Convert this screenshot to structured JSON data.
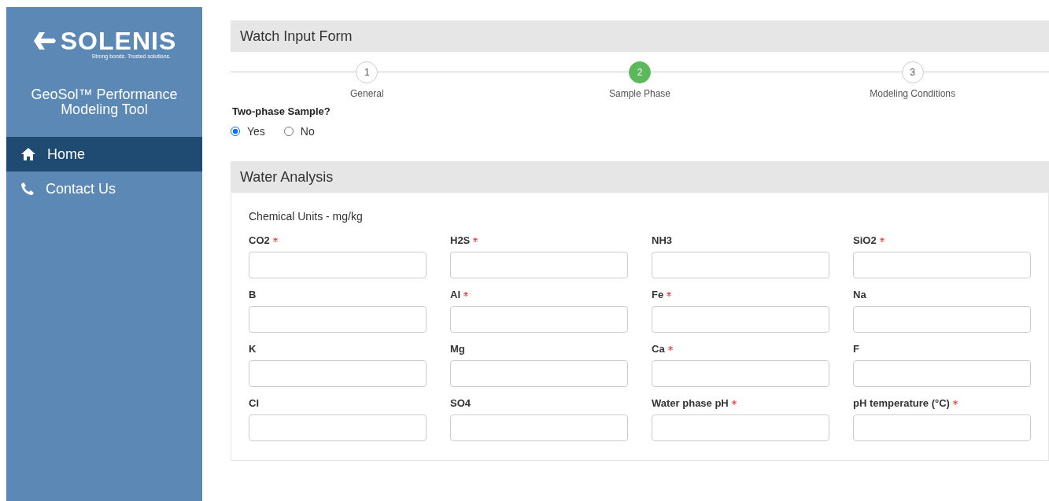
{
  "sidebar": {
    "logo": {
      "wordmark": "SOLENIS",
      "tagline": "Strong bonds. Trusted solutions."
    },
    "app_title": "GeoSol™ Performance Modeling Tool",
    "items": [
      {
        "label": "Home",
        "kind": "home",
        "selected": true
      },
      {
        "label": "Contact Us",
        "kind": "phone",
        "selected": false
      }
    ]
  },
  "form_title": "Watch Input Form",
  "steps": [
    {
      "number": "1",
      "label": "General",
      "selected": false
    },
    {
      "number": "2",
      "label": "Sample Phase",
      "selected": true
    },
    {
      "number": "3",
      "label": "Modeling Conditions",
      "selected": false
    }
  ],
  "two_phase": {
    "question": "Two-phase Sample?",
    "options": [
      {
        "label": "Yes",
        "selected": true
      },
      {
        "label": "No",
        "selected": false
      }
    ]
  },
  "water_analysis": {
    "title": "Water Analysis",
    "units": "Chemical Units - mg/kg",
    "fields": [
      {
        "label": "CO2",
        "required": true
      },
      {
        "label": "H2S",
        "required": true
      },
      {
        "label": "NH3",
        "required": false
      },
      {
        "label": "SiO2",
        "required": true
      },
      {
        "label": "B",
        "required": false
      },
      {
        "label": "Al",
        "required": true
      },
      {
        "label": "Fe",
        "required": true
      },
      {
        "label": "Na",
        "required": false
      },
      {
        "label": "K",
        "required": false
      },
      {
        "label": "Mg",
        "required": false
      },
      {
        "label": "Ca",
        "required": true
      },
      {
        "label": "F",
        "required": false
      },
      {
        "label": "Cl",
        "required": false
      },
      {
        "label": "SO4",
        "required": false
      },
      {
        "label": "Water phase pH",
        "required": true
      },
      {
        "label": "pH temperature (°C)",
        "required": true
      }
    ]
  }
}
